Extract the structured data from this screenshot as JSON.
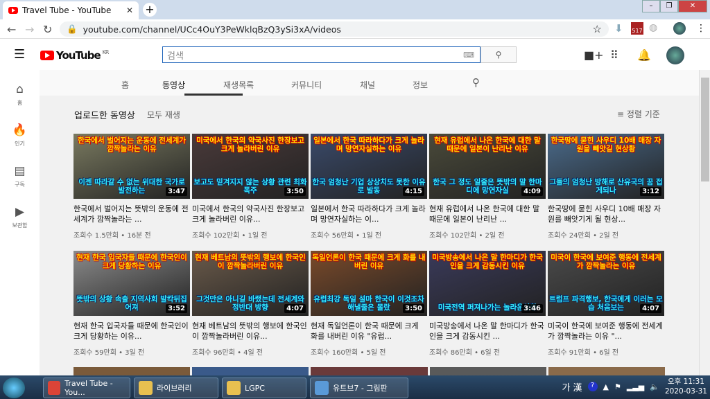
{
  "browser": {
    "tab_title": "Travel Tube - YouTube",
    "url": "youtube.com/channel/UCc4OuY3PeWklqBzQ3ySi3xA/videos",
    "badge": "517"
  },
  "header": {
    "logo": "YouTube",
    "region": "KR",
    "search_placeholder": "검색"
  },
  "sidebar": [
    {
      "icon": "home-icon",
      "label": "홈",
      "glyph": "⌂"
    },
    {
      "icon": "fire-icon",
      "label": "인기",
      "glyph": "🔥"
    },
    {
      "icon": "subscriptions-icon",
      "label": "구독",
      "glyph": "▤"
    },
    {
      "icon": "library-icon",
      "label": "보관함",
      "glyph": "▶"
    }
  ],
  "channel_tabs": [
    "홈",
    "동영상",
    "재생목록",
    "커뮤니티",
    "채널",
    "정보"
  ],
  "section": {
    "title": "업로드한 동영상",
    "play_all": "모두 재생",
    "sort": "정렬 기준"
  },
  "videos": [
    {
      "top": "한국에서 벌어지는 운동에 전세계가 깜짝놀라는 이유",
      "bottom": "이젠 따라갈 수 없는 위대한 국가로 발전하는",
      "duration": "3:47",
      "title": "한국에서 벌어지는 뜻밖의 운동에 전세계가 깜짝놀라는 ...",
      "meta": "조회수 1.5만회 • 16분 전",
      "color": "#7a7a60"
    },
    {
      "top": "미국에서 한국의 약국사진 한장보고 크게 놀라버린 이유",
      "bottom": "보고도 믿겨지지 않는 상황 관련 최화폭주",
      "duration": "3:50",
      "title": "미국에서 한국의 약국사진 한장보고 크게 놀라버린 이유...",
      "meta": "조회수 102만회 • 1일 전",
      "color": "#4a3a3a"
    },
    {
      "top": "일본에서 한국 따라하다가 크게 놀라며 망연자실하는 이유",
      "bottom": "한국 엄청난 기업 상상치도 못한 이유로 발동",
      "duration": "4:15",
      "title": "일본에서 한국 따라하다가 크게 놀라며 망연자실하는 이...",
      "meta": "조회수 56만회 • 1일 전",
      "color": "#3a4a6a"
    },
    {
      "top": "현재 유럽에서 나온 한국에 대한 말 때문에 일본이 난리난 이유",
      "bottom": "한국 그 정도 일줄은 뜻밖의 말 한마디에 망연자실",
      "duration": "4:09",
      "title": "현재 유럽에서 나온 한국에 대한 말 때문에 일본이 난리난 ...",
      "meta": "조회수 102만회 • 2일 전",
      "color": "#4a4a3a"
    },
    {
      "top": "한국땅에 묻힌 사우디 10배 매장 자원을 빼앗길 현상황",
      "bottom": "그들의 엄청난 방해로 산유국의 꿈 접게되나",
      "duration": "3:12",
      "title": "한국땅에 묻힌 사우디 10배 매장 자원를 빼앗기게 될 현상...",
      "meta": "조회수 24만회 • 2일 전",
      "color": "#4a6a8a"
    },
    {
      "top": "현재 한국 입국자들 때문에 한국인이 크게 당황하는 이유",
      "bottom": "뜻밖의 상황 속출 지역사회 발칵뒤집어져",
      "duration": "3:52",
      "title": "현재 한국 입국자들 때문에 한국인이 크게 당황하는 이유...",
      "meta": "조회수 59만회 • 3일 전",
      "color": "#8a8a8a"
    },
    {
      "top": "현재 베트남의 뜻밖의 행보에 한국인이 깜짝놀라버린 이유",
      "bottom": "그것만은 아니길 바랬는데 전세계와 정반대 방향",
      "duration": "4:07",
      "title": "현재 베트남의 뜻밖의 행보에 한국인이 깜짝놀라버린 이유...",
      "meta": "조회수 96만회 • 4일 전",
      "color": "#6a5a4a"
    },
    {
      "top": "독일언론이 한국 때문에 크게 화를 내버린 이유",
      "bottom": "유럽최강 독일 설마 한국이 이것조차 해낼줄은 몰랐",
      "duration": "3:50",
      "title": "현재 독일언론이 한국 때문에 크게 화를 내버린 이유 \"유럽...",
      "meta": "조회수 160만회 • 5일 전",
      "color": "#7a4a2a"
    },
    {
      "top": "미국방송에서 나온 말 한마디가 한국인을 크게 감동시킨 이유",
      "bottom": "미국전역 퍼져나가는 놀라운상황",
      "duration": "3:46",
      "title": "미국방송에서 나온 말 한마디가 한국인을 크게 감동시킨 ...",
      "meta": "조회수 86만회 • 6일 전",
      "color": "#3a3a5a"
    },
    {
      "top": "미국이 한국에 보여준 행동에 전세계가 깜짝놀라는 이유",
      "bottom": "트럼프 파격행보, 한국에게 이러는 모습 처음보는",
      "duration": "4:07",
      "title": "미국이 한국에 보여준 행동에 전세계가 깜짝놀라는 이유 \"...",
      "meta": "조회수 91만회 • 6일 전",
      "color": "#4a4a4a"
    }
  ],
  "taskbar": {
    "items": [
      {
        "label": "Travel Tube - You...",
        "color": "#db4437"
      },
      {
        "label": "라이브러리",
        "color": "#e8c050"
      },
      {
        "label": "LGPC",
        "color": "#e8c050"
      },
      {
        "label": "유트브7 - 그림판",
        "color": "#5a9ad8"
      }
    ],
    "ime": "가 漢",
    "time": "오후 11:31",
    "date": "2020-03-31"
  }
}
